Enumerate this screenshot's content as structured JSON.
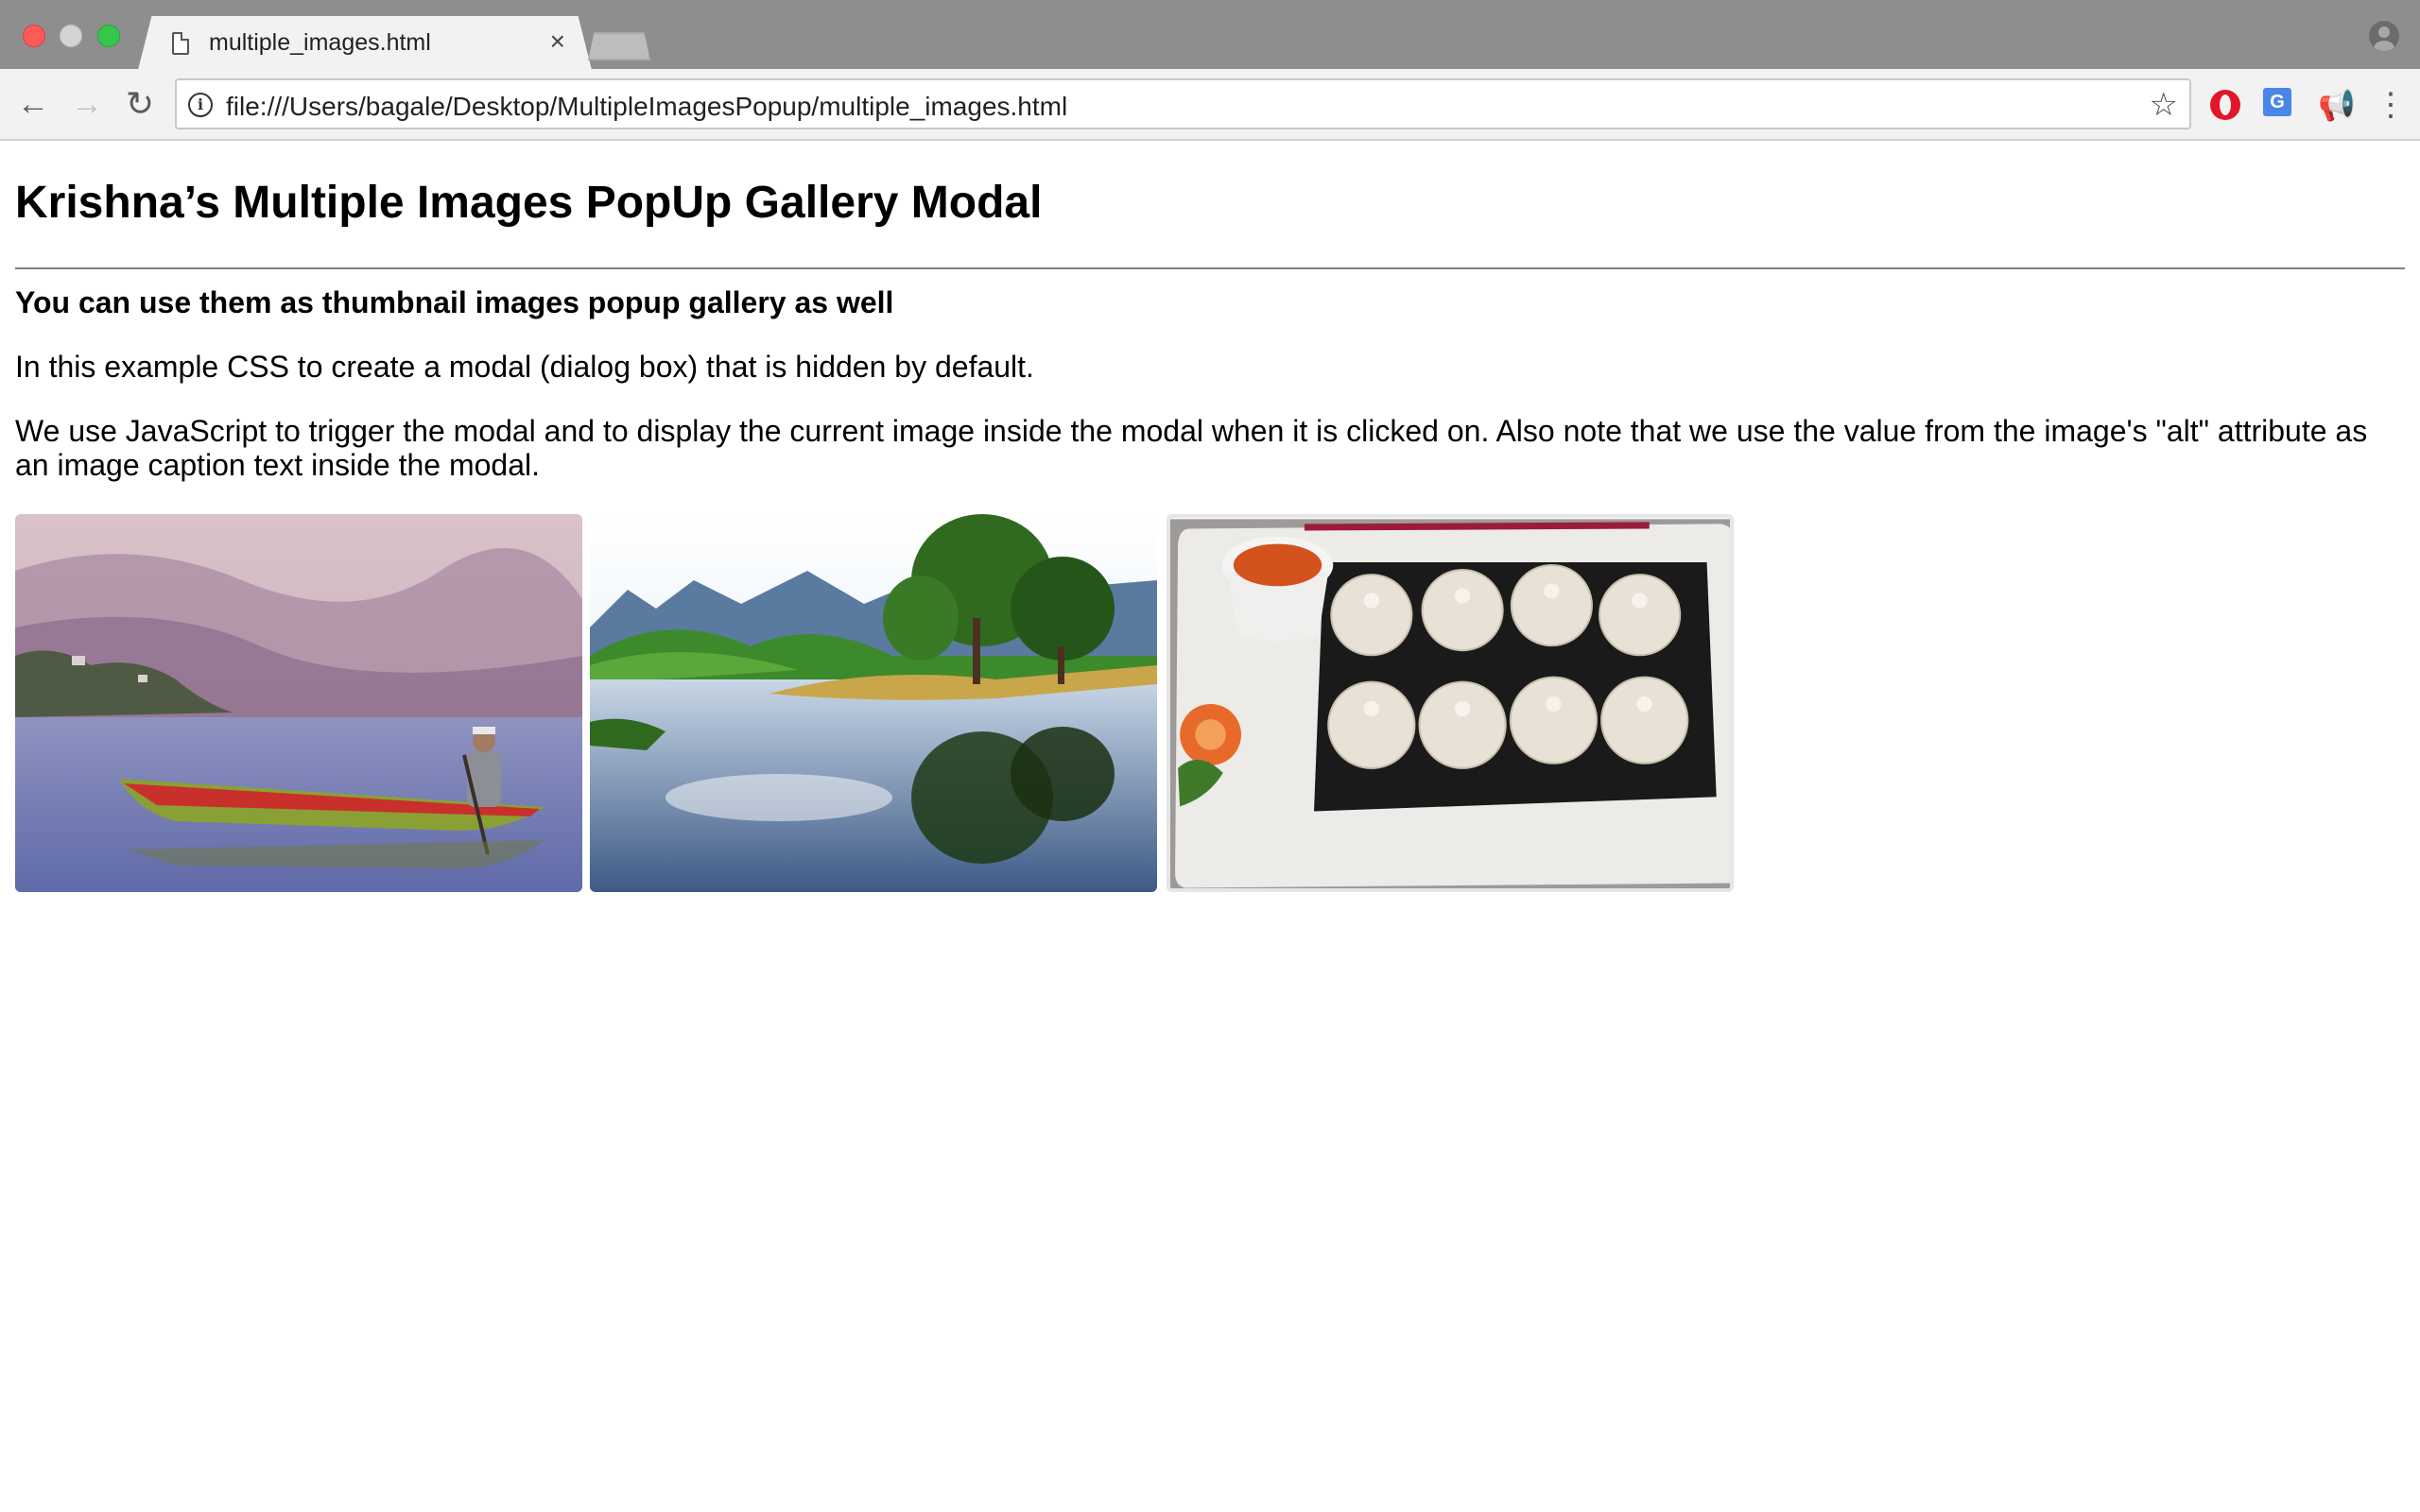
{
  "browser": {
    "tab_title": "multiple_images.html",
    "tab_close_glyph": "×",
    "url": "file:///Users/bagale/Desktop/MultipleImagesPopup/multiple_images.html",
    "icons": [
      "close-window",
      "minimize-window",
      "zoom-window",
      "file-icon",
      "new-tab",
      "profile-icon",
      "back-icon",
      "forward-icon",
      "reload-icon",
      "info-icon",
      "star-icon",
      "opera-extension-icon",
      "translate-extension-icon",
      "megaphone-extension-icon",
      "menu-icon"
    ]
  },
  "page": {
    "title": "Krishna’s Multiple Images PopUp Gallery Modal",
    "subheading": "You can use them as thumbnail images popup gallery as well",
    "paragraph1": "In this example CSS to create a modal (dialog box) that is hidden by default.",
    "paragraph2": "We use JavaScript to trigger the modal and to display the current image inside the modal when it is clicked on. Also note that we use the value from the image's \"alt\" attribute as an image caption text inside the modal."
  },
  "gallery": [
    {
      "subject": "man rowing a wooden boat on a misty mountain lake"
    },
    {
      "subject": "tree-covered island reflected in a calm lake below mountains"
    },
    {
      "subject": "plate of steamed momo dumplings with red dipping sauce"
    }
  ]
}
